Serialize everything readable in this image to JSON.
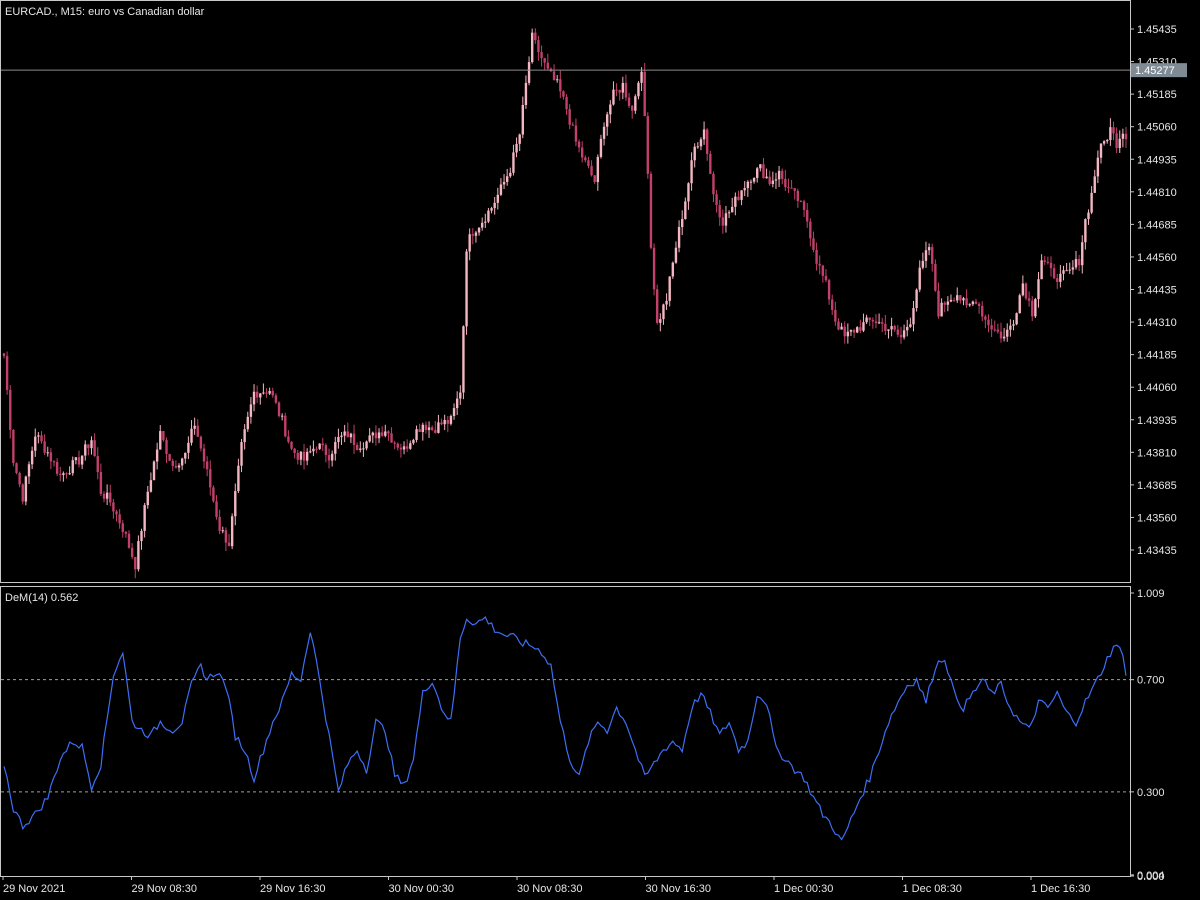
{
  "chart_data": [
    {
      "type": "candlestick",
      "title": "EURCAD., M15:  euro vs Canadian dollar",
      "price_labels": [
        "1.45435",
        "1.45310",
        "1.45185",
        "1.45060",
        "1.44935",
        "1.44810",
        "1.44685",
        "1.44560",
        "1.44435",
        "1.44310",
        "1.44185",
        "1.44060",
        "1.43935",
        "1.43810",
        "1.43685",
        "1.43560",
        "1.43435"
      ],
      "current_price": "1.45277",
      "ylim": [
        1.43375,
        1.45573
      ],
      "candle_color_bull": "#f4b6c2",
      "candle_color_bear": "#c2406b",
      "close_anchors": [
        [
          0,
          1.4418
        ],
        [
          3,
          1.4378
        ],
        [
          6,
          1.4364
        ],
        [
          10,
          1.4388
        ],
        [
          14,
          1.4381
        ],
        [
          18,
          1.4372
        ],
        [
          24,
          1.4378
        ],
        [
          28,
          1.4386
        ],
        [
          31,
          1.4366
        ],
        [
          34,
          1.4362
        ],
        [
          38,
          1.4352
        ],
        [
          42,
          1.4338
        ],
        [
          46,
          1.4366
        ],
        [
          50,
          1.4388
        ],
        [
          54,
          1.4376
        ],
        [
          58,
          1.438
        ],
        [
          61,
          1.4392
        ],
        [
          65,
          1.4373
        ],
        [
          69,
          1.4352
        ],
        [
          72,
          1.4346
        ],
        [
          76,
          1.4383
        ],
        [
          80,
          1.4404
        ],
        [
          85,
          1.4405
        ],
        [
          89,
          1.4393
        ],
        [
          92,
          1.4382
        ],
        [
          96,
          1.4378
        ],
        [
          100,
          1.4384
        ],
        [
          104,
          1.438
        ],
        [
          107,
          1.4386
        ],
        [
          110,
          1.4388
        ],
        [
          113,
          1.4384
        ],
        [
          116,
          1.4385
        ],
        [
          119,
          1.4388
        ],
        [
          122,
          1.439
        ],
        [
          125,
          1.4385
        ],
        [
          128,
          1.4382
        ],
        [
          131,
          1.4388
        ],
        [
          134,
          1.4392
        ],
        [
          137,
          1.439
        ],
        [
          140,
          1.4392
        ],
        [
          143,
          1.4393
        ],
        [
          146,
          1.4405
        ],
        [
          147,
          1.443
        ],
        [
          148,
          1.446
        ],
        [
          150,
          1.4466
        ],
        [
          153,
          1.447
        ],
        [
          156,
          1.4475
        ],
        [
          159,
          1.4482
        ],
        [
          162,
          1.449
        ],
        [
          165,
          1.4503
        ],
        [
          167,
          1.4522
        ],
        [
          169,
          1.454
        ],
        [
          171,
          1.4535
        ],
        [
          174,
          1.4527
        ],
        [
          177,
          1.4522
        ],
        [
          180,
          1.4513
        ],
        [
          183,
          1.45
        ],
        [
          186,
          1.4492
        ],
        [
          189,
          1.4485
        ],
        [
          192,
          1.4508
        ],
        [
          195,
          1.4518
        ],
        [
          198,
          1.4522
        ],
        [
          201,
          1.4512
        ],
        [
          203,
          1.4525
        ],
        [
          204,
          1.4525
        ],
        [
          205,
          1.451
        ],
        [
          206,
          1.449
        ],
        [
          207,
          1.446
        ],
        [
          209,
          1.443
        ],
        [
          212,
          1.444
        ],
        [
          215,
          1.446
        ],
        [
          218,
          1.4478
        ],
        [
          221,
          1.4498
        ],
        [
          224,
          1.4505
        ],
        [
          227,
          1.448
        ],
        [
          230,
          1.447
        ],
        [
          233,
          1.4475
        ],
        [
          236,
          1.4482
        ],
        [
          239,
          1.4487
        ],
        [
          242,
          1.449
        ],
        [
          245,
          1.4485
        ],
        [
          248,
          1.4488
        ],
        [
          251,
          1.4482
        ],
        [
          254,
          1.4478
        ],
        [
          257,
          1.447
        ],
        [
          260,
          1.4455
        ],
        [
          263,
          1.4445
        ],
        [
          266,
          1.4432
        ],
        [
          269,
          1.4425
        ],
        [
          272,
          1.4428
        ],
        [
          275,
          1.443
        ],
        [
          278,
          1.4432
        ],
        [
          281,
          1.443
        ],
        [
          284,
          1.4428
        ],
        [
          287,
          1.4425
        ],
        [
          290,
          1.4432
        ],
        [
          293,
          1.445
        ],
        [
          296,
          1.446
        ],
        [
          299,
          1.4435
        ],
        [
          302,
          1.444
        ],
        [
          305,
          1.4442
        ],
        [
          308,
          1.4436
        ],
        [
          311,
          1.444
        ],
        [
          314,
          1.4432
        ],
        [
          317,
          1.4428
        ],
        [
          320,
          1.4425
        ],
        [
          323,
          1.4432
        ],
        [
          326,
          1.4446
        ],
        [
          329,
          1.4435
        ],
        [
          332,
          1.4455
        ],
        [
          335,
          1.445
        ],
        [
          338,
          1.4448
        ],
        [
          341,
          1.445
        ],
        [
          344,
          1.4455
        ],
        [
          346,
          1.447
        ],
        [
          348,
          1.448
        ],
        [
          350,
          1.4495
        ],
        [
          352,
          1.45
        ],
        [
          354,
          1.4505
        ],
        [
          356,
          1.45
        ],
        [
          358,
          1.4505
        ],
        [
          359,
          1.4502
        ]
      ]
    },
    {
      "type": "line",
      "title": "DeM(14) 0.562",
      "series": [
        {
          "values_ref": "computed",
          "color": "#3d6ef5"
        }
      ],
      "ylim": [
        0.0,
        1.009
      ],
      "ytick_labels": [
        "1.009",
        "0.700",
        "0.300",
        "0.004",
        "0.000"
      ],
      "levels": [
        0.7,
        0.3
      ],
      "anchors": [
        [
          0,
          0.4
        ],
        [
          3,
          0.24
        ],
        [
          6,
          0.18
        ],
        [
          10,
          0.22
        ],
        [
          14,
          0.28
        ],
        [
          18,
          0.42
        ],
        [
          22,
          0.48
        ],
        [
          25,
          0.46
        ],
        [
          28,
          0.32
        ],
        [
          31,
          0.4
        ],
        [
          35,
          0.72
        ],
        [
          38,
          0.8
        ],
        [
          41,
          0.55
        ],
        [
          44,
          0.52
        ],
        [
          47,
          0.5
        ],
        [
          50,
          0.55
        ],
        [
          54,
          0.52
        ],
        [
          57,
          0.55
        ],
        [
          60,
          0.68
        ],
        [
          63,
          0.75
        ],
        [
          65,
          0.7
        ],
        [
          68,
          0.73
        ],
        [
          71,
          0.68
        ],
        [
          74,
          0.5
        ],
        [
          77,
          0.45
        ],
        [
          80,
          0.35
        ],
        [
          83,
          0.45
        ],
        [
          86,
          0.55
        ],
        [
          89,
          0.62
        ],
        [
          92,
          0.72
        ],
        [
          95,
          0.7
        ],
        [
          98,
          0.88
        ],
        [
          101,
          0.7
        ],
        [
          104,
          0.5
        ],
        [
          107,
          0.3
        ],
        [
          110,
          0.4
        ],
        [
          113,
          0.45
        ],
        [
          116,
          0.38
        ],
        [
          119,
          0.55
        ],
        [
          122,
          0.52
        ],
        [
          125,
          0.36
        ],
        [
          128,
          0.32
        ],
        [
          131,
          0.42
        ],
        [
          134,
          0.65
        ],
        [
          137,
          0.7
        ],
        [
          140,
          0.6
        ],
        [
          143,
          0.55
        ],
        [
          146,
          0.85
        ],
        [
          148,
          0.92
        ],
        [
          151,
          0.9
        ],
        [
          154,
          0.92
        ],
        [
          157,
          0.88
        ],
        [
          160,
          0.86
        ],
        [
          163,
          0.85
        ],
        [
          166,
          0.83
        ],
        [
          169,
          0.82
        ],
        [
          172,
          0.8
        ],
        [
          175,
          0.75
        ],
        [
          178,
          0.55
        ],
        [
          181,
          0.42
        ],
        [
          184,
          0.35
        ],
        [
          187,
          0.48
        ],
        [
          190,
          0.55
        ],
        [
          193,
          0.52
        ],
        [
          196,
          0.6
        ],
        [
          199,
          0.55
        ],
        [
          202,
          0.45
        ],
        [
          205,
          0.35
        ],
        [
          208,
          0.4
        ],
        [
          211,
          0.45
        ],
        [
          214,
          0.48
        ],
        [
          217,
          0.45
        ],
        [
          220,
          0.6
        ],
        [
          223,
          0.65
        ],
        [
          226,
          0.58
        ],
        [
          229,
          0.5
        ],
        [
          232,
          0.55
        ],
        [
          235,
          0.45
        ],
        [
          238,
          0.48
        ],
        [
          241,
          0.65
        ],
        [
          244,
          0.62
        ],
        [
          247,
          0.45
        ],
        [
          250,
          0.42
        ],
        [
          253,
          0.38
        ],
        [
          256,
          0.35
        ],
        [
          259,
          0.28
        ],
        [
          262,
          0.22
        ],
        [
          265,
          0.18
        ],
        [
          268,
          0.12
        ],
        [
          271,
          0.2
        ],
        [
          274,
          0.28
        ],
        [
          277,
          0.35
        ],
        [
          280,
          0.45
        ],
        [
          283,
          0.55
        ],
        [
          286,
          0.62
        ],
        [
          289,
          0.68
        ],
        [
          292,
          0.7
        ],
        [
          295,
          0.62
        ],
        [
          298,
          0.75
        ],
        [
          301,
          0.78
        ],
        [
          304,
          0.65
        ],
        [
          307,
          0.6
        ],
        [
          310,
          0.65
        ],
        [
          313,
          0.7
        ],
        [
          316,
          0.65
        ],
        [
          319,
          0.68
        ],
        [
          322,
          0.6
        ],
        [
          325,
          0.55
        ],
        [
          328,
          0.52
        ],
        [
          331,
          0.62
        ],
        [
          334,
          0.6
        ],
        [
          337,
          0.65
        ],
        [
          340,
          0.58
        ],
        [
          343,
          0.55
        ],
        [
          346,
          0.62
        ],
        [
          349,
          0.68
        ],
        [
          352,
          0.75
        ],
        [
          355,
          0.82
        ],
        [
          358,
          0.8
        ],
        [
          359,
          0.72
        ]
      ]
    }
  ],
  "x_axis": {
    "labels": [
      "29 Nov 2021",
      "29 Nov 08:30",
      "29 Nov 16:30",
      "30 Nov 00:30",
      "30 Nov 08:30",
      "30 Nov 16:30",
      "1 Dec 00:30",
      "1 Dec 08:30",
      "1 Dec 16:30"
    ]
  },
  "colors": {
    "background": "#000000",
    "text": "#e6e6e6",
    "grid_level": "#a0a0a0",
    "current_price_box": "#7f8b94"
  }
}
